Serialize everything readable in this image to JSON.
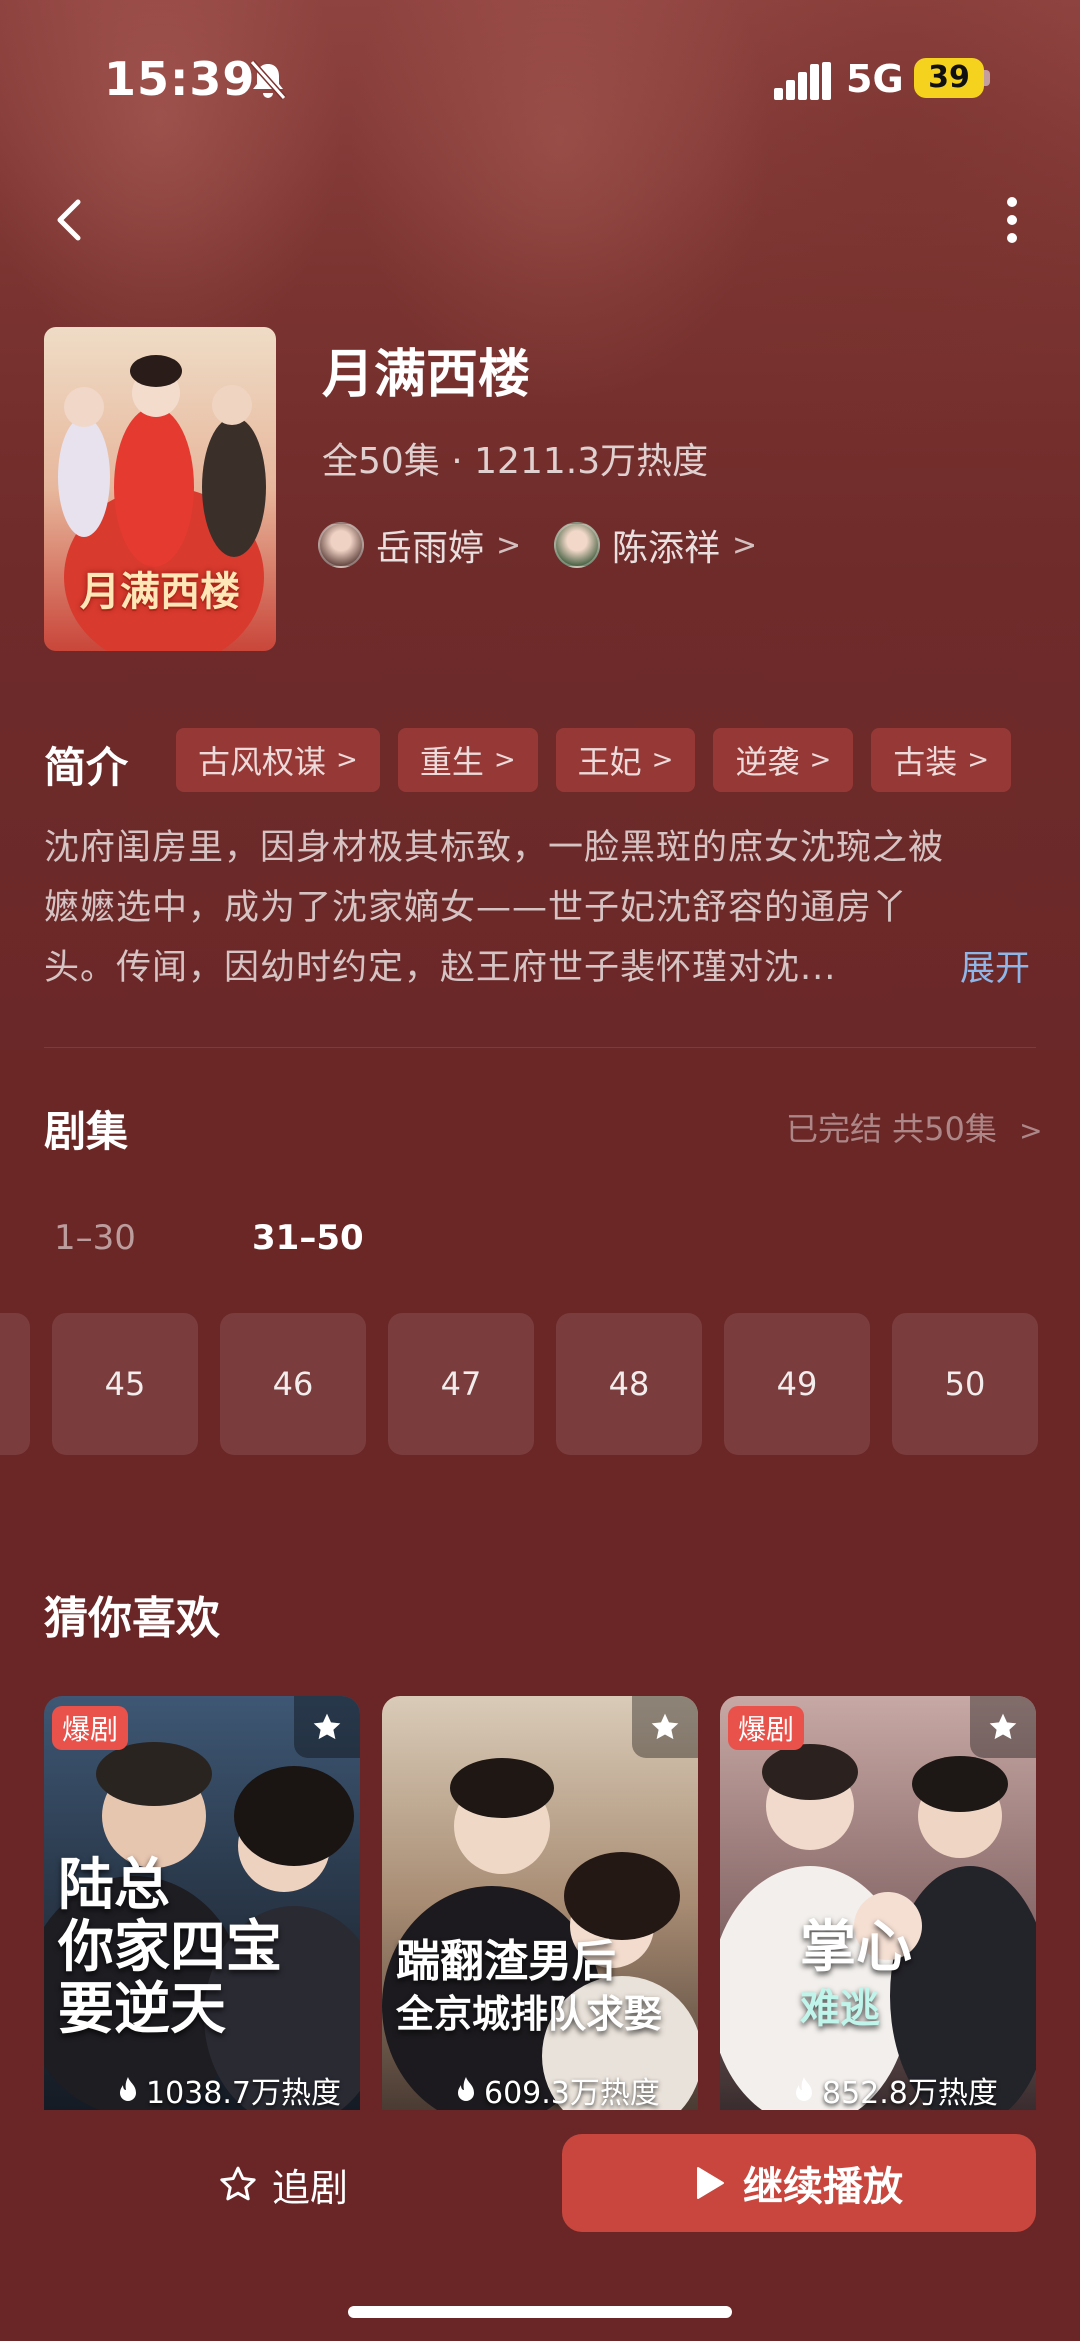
{
  "status_bar": {
    "time": "15:39",
    "network": "5G",
    "battery": "39",
    "icons": [
      "mute-bell-icon",
      "signal-icon"
    ]
  },
  "nav": {
    "icons": [
      "back-icon",
      "more-icon"
    ]
  },
  "drama": {
    "poster_title": "月满西楼",
    "title": "月满西楼",
    "meta": "全50集 · 1211.3万热度",
    "actors": [
      {
        "name": "岳雨婷"
      },
      {
        "name": "陈添祥"
      }
    ]
  },
  "synopsis": {
    "heading": "简介",
    "tags": [
      "古风权谋",
      "重生",
      "王妃",
      "逆袭",
      "古装"
    ],
    "line1": "沈府闺房里，因身材极其标致，一脸黑斑的庶女沈琬之被",
    "line2": "嬷嬷选中，成为了沈家嫡女——世子妃沈舒容的通房丫",
    "line3": "头。传闻，因幼时约定，赵王府世子裴怀瑾对沈...",
    "expand_label": "展开"
  },
  "episodes": {
    "heading": "剧集",
    "status": "已完结 共50集",
    "ranges": [
      "1–30",
      "31–50"
    ],
    "active_range": "31–50",
    "visible": [
      "45",
      "46",
      "47",
      "48",
      "49",
      "50"
    ]
  },
  "recommendations": {
    "heading": "猜你喜欢",
    "cards": [
      {
        "badge": "爆剧",
        "title_line1": "陆总",
        "title_line2": "你家四宝",
        "title_line3": "要逆天",
        "heat": "1038.7万热度"
      },
      {
        "badge": "",
        "title_line1": "",
        "title_line2": "踹翻渣男后",
        "title_line3": "全京城排队求娶",
        "heat": "609.3万热度"
      },
      {
        "badge": "爆剧",
        "title_line1": "",
        "title_line2": "掌心",
        "title_line3": "难逃",
        "heat": "852.8万热度"
      }
    ]
  },
  "actions": {
    "follow_label": "追剧",
    "play_label": "继续播放"
  },
  "colors": {
    "background": "#6b2626",
    "accent": "#c8463d",
    "badge": "#e8524a",
    "link": "#8fb6e8",
    "battery": "#f5d21e"
  }
}
